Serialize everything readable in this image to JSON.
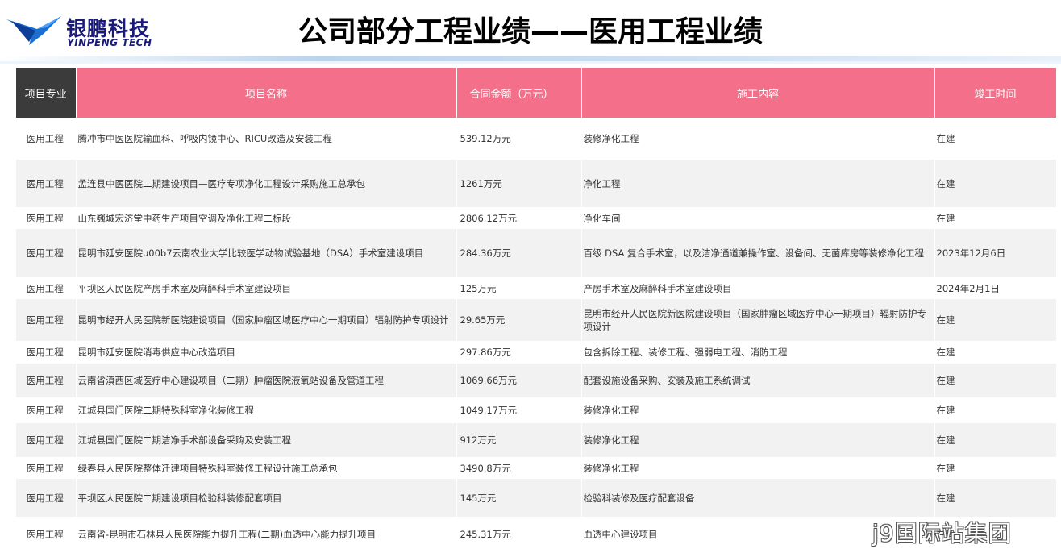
{
  "logo": {
    "cn": "银鹏科技",
    "en": "YINPENG TECH"
  },
  "title": "公司部分工程业绩——医用工程业绩",
  "table": {
    "headers": [
      "项目专业",
      "项目名称",
      "合同金额（万元）",
      "施工内容",
      "竣工时间"
    ],
    "rows": [
      [
        "医用工程",
        "腾冲市中医医院输血科、呼吸内镜中心、RICU改造及安装工程",
        "539.12万元",
        "装修净化工程",
        "在建"
      ],
      [
        "医用工程",
        "孟连县中医医院二期建设项目—医疗专项净化工程设计采购施工总承包",
        "1261万元",
        "净化工程",
        "在建"
      ],
      [
        "医用工程",
        "山东巍城宏济堂中药生产项目空调及净化工程二标段",
        "2806.12万元",
        "净化车间",
        "在建"
      ],
      [
        "医用工程",
        "昆明市延安医院u00b7云南农业大学比较医学动物试验基地（DSA）手术室建设项目",
        "284.36万元",
        "百级 DSA 复合手术室，以及洁净通道兼操作室、设备间、无菌库房等装修净化工程",
        "2023年12月6日"
      ],
      [
        "医用工程",
        "平坝区人民医院产房手术室及麻醉科手术室建设项目",
        "125万元",
        "产房手术室及麻醉科手术室建设项目",
        "2024年2月1日"
      ],
      [
        "医用工程",
        "昆明市经开人民医院新医院建设项目（国家肿瘤区域医疗中心一期项目）辐射防护专项设计",
        "29.65万元",
        "昆明市经开人民医院新医院建设项目（国家肿瘤区域医疗中心一期项目）辐射防护专项设计",
        "在建"
      ],
      [
        "医用工程",
        "昆明市延安医院消毒供应中心改造项目",
        "297.86万元",
        "包含拆除工程、装修工程、强弱电工程、消防工程",
        "在建"
      ],
      [
        "医用工程",
        "云南省滇西区域医疗中心建设项目（二期）肿瘤医院液氧站设备及管道工程",
        "1069.66万元",
        "配套设施设备采购、安装及施工系统调试",
        "在建"
      ],
      [
        "医用工程",
        "江城县国门医院二期特殊科室净化装修工程",
        "1049.17万元",
        "装修净化工程",
        "在建"
      ],
      [
        "医用工程",
        "江城县国门医院二期洁净手术部设备采购及安装工程",
        "912万元",
        "装修净化工程",
        "在建"
      ],
      [
        "医用工程",
        "绿春县人民医院整体迁建项目特殊科室装修工程设计施工总承包",
        "3490.8万元",
        "装修净化工程",
        "在建"
      ],
      [
        "医用工程",
        "平坝区人民医院二期建设项目检验科装修配套项目",
        "145万元",
        "检验科装修及医疗配套设备",
        "在建"
      ],
      [
        "医用工程",
        "云南省-昆明市石林县人民医院能力提升工程(二期)血透中心能力提升项目",
        "245.31万元",
        "血透中心建设项目",
        "在建"
      ]
    ]
  },
  "watermark": "j9国际站集团"
}
